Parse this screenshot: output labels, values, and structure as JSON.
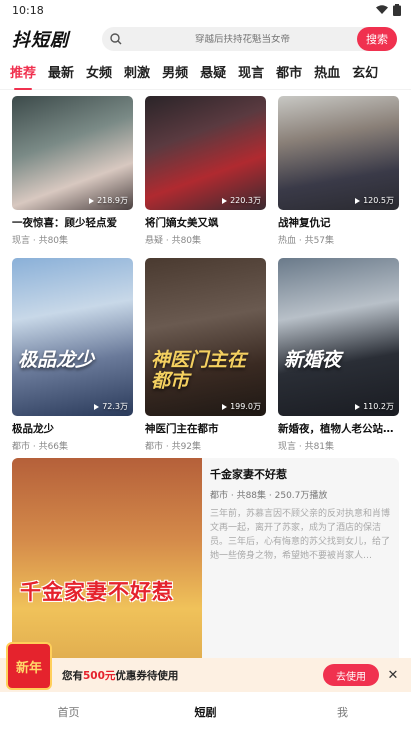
{
  "status_bar": {
    "time": "10:18",
    "wifi_icon": "wifi-icon",
    "battery_icon": "battery-icon"
  },
  "header": {
    "logo": "抖短剧",
    "search": {
      "placeholder": "穿越后扶持花魁当女帝",
      "button": "搜索"
    }
  },
  "tabs": [
    {
      "label": "推荐",
      "active": true
    },
    {
      "label": "最新"
    },
    {
      "label": "女频"
    },
    {
      "label": "刺激"
    },
    {
      "label": "男频"
    },
    {
      "label": "悬疑"
    },
    {
      "label": "现言"
    },
    {
      "label": "都市"
    },
    {
      "label": "热血"
    },
    {
      "label": "玄幻"
    }
  ],
  "cards": [
    {
      "title": "一夜惊喜：顾少轻点爱",
      "meta": "现言 · 共80集",
      "views": "218.9万",
      "poster": ""
    },
    {
      "title": "将门嫡女美又飒",
      "meta": "悬疑 · 共80集",
      "views": "220.3万",
      "poster": ""
    },
    {
      "title": "战神复仇记",
      "meta": "热血 · 共57集",
      "views": "120.5万",
      "poster": ""
    },
    {
      "title": "极品龙少",
      "meta": "都市 · 共66集",
      "views": "72.3万",
      "poster": "极品龙少"
    },
    {
      "title": "神医门主在都市",
      "meta": "都市 · 共92集",
      "views": "199.0万",
      "poster": "神医门主在都市"
    },
    {
      "title": "新婚夜，植物人老公站起来了",
      "meta": "现言 · 共81集",
      "views": "110.2万",
      "poster": "新婚夜"
    }
  ],
  "featured": {
    "poster": "千金家妻不好惹",
    "title": "千金家妻不好惹",
    "meta": "都市 · 共88集 · 250.7万播放",
    "desc": "三年前，苏慕言因不顾父亲的反对执意和肖博文再一起，离开了苏家，成为了酒店的保洁员。三年后，心有悔意的苏父找到女儿，给了她一些傍身之物，希望她不要被肖家人…"
  },
  "promo": {
    "badge": "新年",
    "text_before": "您有",
    "amount": "500元",
    "text_after": "优惠券待使用",
    "button": "去使用",
    "close": "✕"
  },
  "bottom_nav": [
    {
      "label": "首页"
    },
    {
      "label": "短剧",
      "active": true
    },
    {
      "label": "我"
    }
  ],
  "colors": {
    "accent": "#f0314f",
    "promo_bg": "#fdf0e2"
  }
}
